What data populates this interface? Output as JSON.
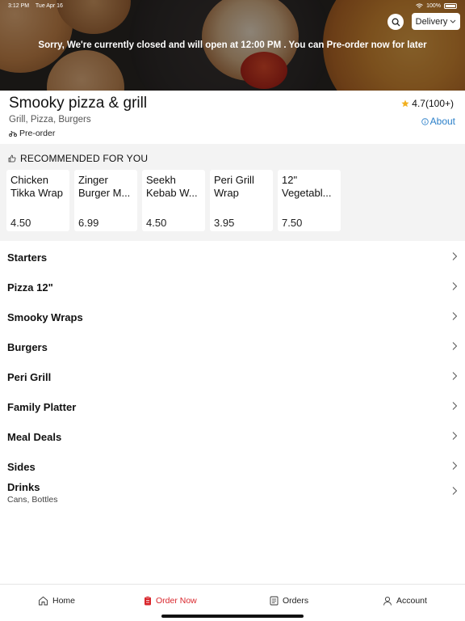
{
  "status_bar": {
    "time": "3:12 PM",
    "date": "Tue Apr 16",
    "battery": "100%"
  },
  "header": {
    "delivery_label": "Delivery",
    "closed_message": "Sorry, We're currently closed and will open at 12:00 PM . You can Pre-order now for later"
  },
  "restaurant": {
    "name": "Smooky pizza & grill",
    "cuisines": "Grill, Pizza, Burgers",
    "preorder_label": "Pre-order",
    "rating": "4.7(100+)",
    "about_label": "About"
  },
  "recommended": {
    "title": "RECOMMENDED FOR YOU",
    "items": [
      {
        "name": "Chicken Tikka Wrap",
        "price": "4.50"
      },
      {
        "name": "Zinger Burger M...",
        "price": "6.99"
      },
      {
        "name": "Seekh Kebab W...",
        "price": "4.50"
      },
      {
        "name": "Peri Grill Wrap",
        "price": "3.95"
      },
      {
        "name": "12\" Vegetabl...",
        "price": "7.50"
      }
    ]
  },
  "categories": [
    {
      "label": "Starters"
    },
    {
      "label": "Pizza 12\""
    },
    {
      "label": "Smooky Wraps"
    },
    {
      "label": "Burgers"
    },
    {
      "label": "Peri Grill"
    },
    {
      "label": "Family Platter"
    },
    {
      "label": "Meal Deals"
    },
    {
      "label": "Sides"
    },
    {
      "label": "Drinks",
      "sub": "Cans, Bottles"
    }
  ],
  "nav": {
    "home": "Home",
    "order_now": "Order Now",
    "orders": "Orders",
    "account": "Account"
  },
  "colors": {
    "accent": "#d9262c",
    "link": "#2a7fc9",
    "star": "#f2b01e"
  },
  "icons": [
    "search-icon",
    "chevron-down-icon",
    "bike-icon",
    "star-icon",
    "info-icon",
    "thumbs-up-icon",
    "chevron-right-icon",
    "home-icon",
    "order-icon",
    "orders-list-icon",
    "account-icon"
  ]
}
